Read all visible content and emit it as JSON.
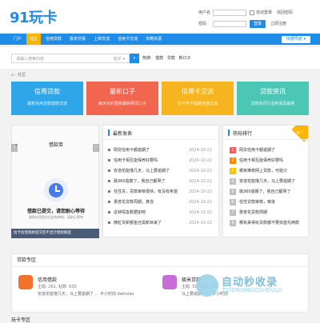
{
  "header": {
    "logo_text": "91玩卡",
    "login": {
      "username_label": "用户名",
      "password_label": "密码",
      "auto_login": "自动登录",
      "forgot": "找回密码",
      "login_button": "登录",
      "register": "立即注册"
    }
  },
  "nav": {
    "items": [
      {
        "label": "门户"
      },
      {
        "label": "社区"
      },
      {
        "label": "信用贷款"
      },
      {
        "label": "极米交易"
      },
      {
        "label": "上岸交流"
      },
      {
        "label": "信用卡交流"
      },
      {
        "label": "攻略资源"
      }
    ],
    "quick_nav": "快捷导航"
  },
  "search": {
    "placeholder": "请输入搜索内容",
    "scope": "帖子",
    "hot_label": "热搜:",
    "hot_terms": [
      "借款",
      "贷款",
      "新口子"
    ]
  },
  "breadcrumb": "› 社区",
  "cards": [
    {
      "title": "信用贷款",
      "desc": "最新信用贷款借款交流",
      "color": "#2fa6e8"
    },
    {
      "title": "最新口子",
      "desc": "每天实时更新最新网贷口子",
      "color": "#f1664f"
    },
    {
      "title": "信用卡交流",
      "desc": "办卡养卡提额全面交流",
      "color": "#f6b51e"
    },
    {
      "title": "贷款资讯",
      "desc": "贷款资讯行业新闻及解答",
      "color": "#4cc7b6"
    }
  ],
  "slider": {
    "page_title": "借款单",
    "status_title": "借款已提交，请您耐心等待",
    "status_desc": "借款信息提交后会有审核，请耐心等待",
    "caption": "拉卡拉借钱款提交后不显示借款额度",
    "prev_label": "‹",
    "next_label": "›"
  },
  "latest": {
    "title": "最新发表",
    "items": [
      {
        "title": "网贷信用卡都逾期了",
        "date": "2024-10-22"
      },
      {
        "title": "信用卡相互能保养好要吗",
        "date": "2024-10-22"
      },
      {
        "title": "安逸花能撸几天，马上要逾期了",
        "date": "2024-10-22"
      },
      {
        "title": "融360逾期了，我自己都哭了",
        "date": "2024-10-22"
      },
      {
        "title": "任性贷，贷款审核很快，有没有希望",
        "date": "2024-10-22"
      },
      {
        "title": "惠普花贷款周期，真伐",
        "date": "2024-10-22"
      },
      {
        "title": "这钟情急数据如吧",
        "date": "2024-10-22"
      },
      {
        "title": "微粒贷新额金还需新目来了",
        "date": "2024-10-22"
      }
    ]
  },
  "ranking": {
    "title": "热帖排行",
    "badge": "热门",
    "items": [
      {
        "num": "1",
        "title": "网贷信用卡都逾期了"
      },
      {
        "num": "2",
        "title": "信用卡相互能保养好要吗"
      },
      {
        "num": "3",
        "title": "哪家推荐网上贷款，可能只"
      },
      {
        "num": "4",
        "title": "安逸花能撸几天，马上要逾期了"
      },
      {
        "num": "5",
        "title": "融360逾期了，我自己都哭了"
      },
      {
        "num": "6",
        "title": "任性贷款审核，审批"
      },
      {
        "num": "7",
        "title": "惠普花贷款周期"
      },
      {
        "num": "8",
        "title": "哪有来得玩贷款都不要找首先两款"
      }
    ]
  },
  "loan_zone": {
    "title": "贷款专区",
    "apps": [
      {
        "name": "信用借款",
        "meta": "主题: 261, 帖数: 630",
        "desc": "安逸花能撸几天，马上要逾期了 ... 半小时前 dalnsiao",
        "color": "#f3722c"
      },
      {
        "name": "极米贷款",
        "meta": "主题: 59, 帖数: 186",
        "desc": "马上要逾期了 ... 半小时前",
        "color": "#c86dd7"
      }
    ]
  },
  "bottom_title": "玩卡专区",
  "watermark": {
    "text": "自动秒收录",
    "sub": "ZIDONGMIAOSHOULU"
  }
}
